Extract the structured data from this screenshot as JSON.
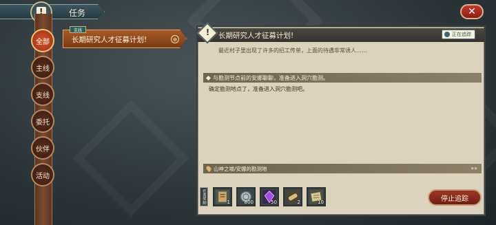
{
  "header": {
    "title": "任务",
    "close_symbol": "✕"
  },
  "filters": [
    {
      "label": "全部",
      "active": true
    },
    {
      "label": "主线",
      "active": false
    },
    {
      "label": "支线",
      "active": false
    },
    {
      "label": "委托",
      "active": false
    },
    {
      "label": "伙伴",
      "active": false
    },
    {
      "label": "活动",
      "active": false
    }
  ],
  "quest_list": {
    "tag": "支线",
    "items": [
      {
        "name": "长期研究人才征募计划!"
      }
    ]
  },
  "detail": {
    "title": "长期研究人才征募计划!",
    "tracking_label": "正在追踪",
    "description": "最近村子里出现了许多的招工传单，上面的待遇非常诱人……",
    "objective": "与勘测节点前的安娜聊聊，准备进入洞穴勘测。",
    "objective_detail": "确定勘测地点了，准备进入洞穴勘测吧。",
    "location": "山神之墟/安娜的勘测地",
    "location_arrows": "»»",
    "rewards_label": "任务奖励",
    "rewards": [
      {
        "icon": "scroll-map-icon",
        "qty": "1"
      },
      {
        "icon": "silver-coin-icon",
        "qty": "800"
      },
      {
        "icon": "purple-crystal-icon",
        "qty": "50"
      },
      {
        "icon": "parchment-roll-icon",
        "qty": "2"
      },
      {
        "icon": "blueprint-icon",
        "qty": "10"
      }
    ],
    "stop_button": "停止追踪"
  }
}
